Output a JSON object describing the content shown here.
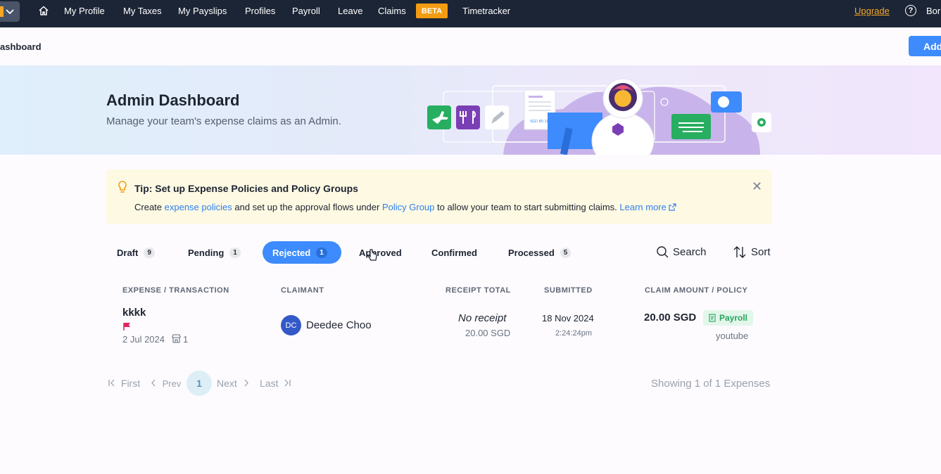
{
  "nav": {
    "items": [
      "My Profile",
      "My Taxes",
      "My Payslips",
      "Profiles",
      "Payroll",
      "Leave",
      "Claims",
      "Timetracker"
    ],
    "beta": "BETA",
    "upgrade": "Upgrade",
    "help": "?",
    "user": "Bor"
  },
  "page": {
    "breadcrumb": "ashboard",
    "add_button": "Add"
  },
  "hero": {
    "title": "Admin Dashboard",
    "subtitle": "Manage your team's expense claims as an Admin.",
    "receipt_text": "SGD 80.10"
  },
  "tip": {
    "title": "Tip: Set up Expense Policies and Policy Groups",
    "body_1": "Create ",
    "link_1": "expense policies",
    "body_2": " and set up the approval flows under ",
    "link_2": "Policy Group",
    "body_3": " to allow your team to start submitting claims. ",
    "link_3": "Learn more"
  },
  "tabs": [
    {
      "label": "Draft",
      "count": "9"
    },
    {
      "label": "Pending",
      "count": "1"
    },
    {
      "label": "Rejected",
      "count": "1"
    },
    {
      "label": "Approved",
      "count": ""
    },
    {
      "label": "Confirmed",
      "count": ""
    },
    {
      "label": "Processed",
      "count": "5"
    }
  ],
  "tools": {
    "search": "Search",
    "sort": "Sort"
  },
  "table": {
    "headers": [
      "EXPENSE / TRANSACTION",
      "CLAIMANT",
      "RECEIPT TOTAL",
      "SUBMITTED",
      "CLAIM AMOUNT / POLICY"
    ],
    "rows": [
      {
        "title": "kkkk",
        "date": "2 Jul 2024",
        "merchant_count": "1",
        "claimant_initials": "DC",
        "claimant": "Deedee Choo",
        "receipt": "No receipt",
        "receipt_amount": "20.00 SGD",
        "submitted_date": "18 Nov 2024",
        "submitted_time": "2:24:24pm",
        "claim_amount": "20.00 SGD",
        "policy": "Payroll",
        "category": "youtube"
      }
    ]
  },
  "pagination": {
    "first": "First",
    "prev": "Prev",
    "current": "1",
    "next": "Next",
    "last": "Last",
    "summary": "Showing 1 of 1 Expenses"
  },
  "colors": {
    "nav_bg": "#1c2536",
    "accent": "#3d8bfd",
    "beta": "#f39c12",
    "tip_bg": "#fdf9e3"
  }
}
